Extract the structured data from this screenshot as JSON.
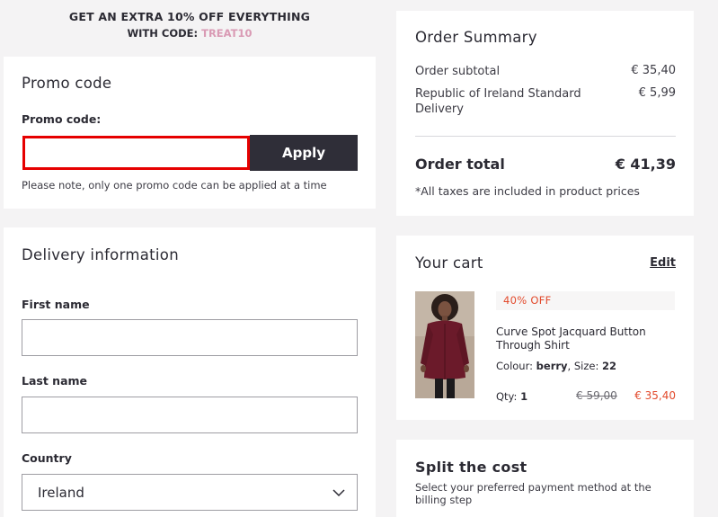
{
  "banner": {
    "line1": "GET AN EXTRA 10% OFF EVERYTHING",
    "line2_prefix": "WITH CODE: ",
    "code": "TREAT10",
    "code_color": "#d99ab4"
  },
  "promo": {
    "title": "Promo code",
    "label": "Promo code:",
    "input_value": "",
    "apply_label": "Apply",
    "note": "Please note, only one promo code can be applied at a time"
  },
  "delivery": {
    "title": "Delivery information",
    "first_name_label": "First name",
    "first_name_value": "",
    "last_name_label": "Last name",
    "last_name_value": "",
    "country_label": "Country",
    "country_value": "Ireland"
  },
  "summary": {
    "title": "Order Summary",
    "subtotal_label": "Order subtotal",
    "subtotal_value": "€ 35,40",
    "shipping_label": "Republic of Ireland Standard Delivery",
    "shipping_value": "€ 5,99",
    "total_label": "Order total",
    "total_value": "€ 41,39",
    "tax_note": "*All taxes are included in product prices"
  },
  "cart": {
    "title": "Your cart",
    "edit_label": "Edit",
    "discount_badge": "40% OFF",
    "product_name": "Curve Spot Jacquard Button Through Shirt",
    "colour_label": "Colour: ",
    "colour_value": "berry",
    "size_label": ", Size: ",
    "size_value": "22",
    "qty_label": "Qty: ",
    "qty_value": "1",
    "original_price": "€ 59,00",
    "sale_price": "€ 35,40",
    "sale_color": "#e24a2c"
  },
  "split": {
    "title": "Split the cost",
    "description": "Select your preferred payment method at the billing step"
  },
  "colors": {
    "page_bg": "#f4f3f4",
    "apply_button_bg": "#2f2e38",
    "input_error_border": "#e60000"
  },
  "icons": {
    "country_select": "chevron-down-icon",
    "product_image": "product-thumbnail"
  }
}
